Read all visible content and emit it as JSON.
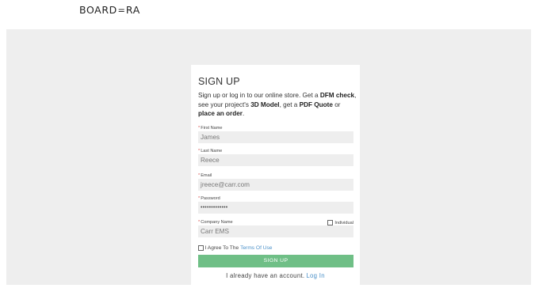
{
  "header": {
    "logo_left": "BOARD",
    "logo_mid": "=",
    "logo_right": "RA"
  },
  "form": {
    "title": "SIGN UP",
    "desc": {
      "p1": "Sign up or log in to our online store. Get a ",
      "b1": "DFM check",
      "p2": ", see your project's ",
      "b2": "3D Model",
      "p3": ", get a ",
      "b3": "PDF Quote",
      "p4": " or ",
      "b4": "place an order",
      "p5": "."
    },
    "required_marker": "*",
    "fields": {
      "first_name": {
        "label": "First Name",
        "value": "James"
      },
      "last_name": {
        "label": "Last Name",
        "value": "Reece"
      },
      "email": {
        "label": "Email",
        "value": "jreece@carr.com"
      },
      "password": {
        "label": "Password",
        "value": "•••••••••••••"
      },
      "company": {
        "label": "Company Name",
        "value": "Carr EMS"
      }
    },
    "individual_label": "Individual",
    "agree_text": "I Agree To The",
    "terms_link": "Terms Of Use",
    "submit_label": "SIGN UP",
    "login_text": "I already have an account.",
    "login_link": "Log In"
  },
  "colors": {
    "accent_button": "#6fbf86",
    "link": "#4a90c8",
    "required": "#d9534f",
    "page_bg": "#eeeeee"
  }
}
